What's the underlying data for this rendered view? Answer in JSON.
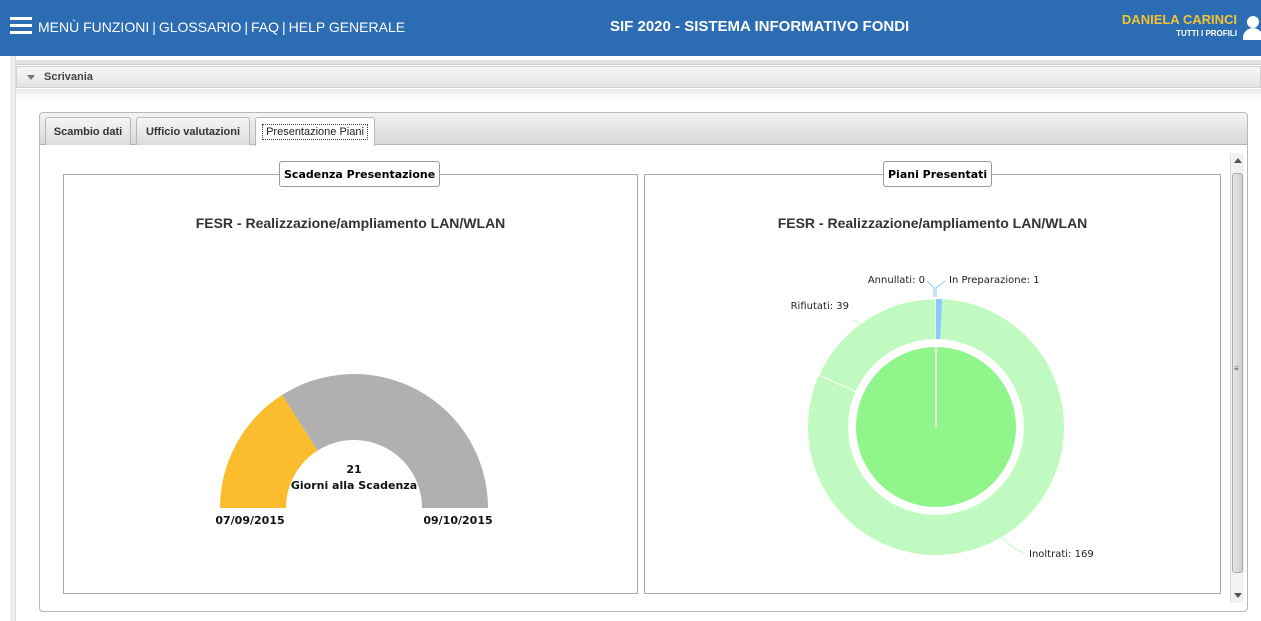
{
  "header": {
    "menu": [
      "MENÙ FUNZIONI",
      "GLOSSARIO",
      "FAQ",
      "HELP GENERALE"
    ],
    "app_title": "SIF 2020 - SISTEMA INFORMATIVO FONDI",
    "user_name": "DANIELA CARINCI",
    "profile": "TUTTI I PROFILI",
    "colors": {
      "bar": "#2b6cb3",
      "user_name": "#f4c430"
    }
  },
  "section": {
    "label": "Scrivania"
  },
  "tabs": [
    {
      "label": "Scambio dati",
      "active": false
    },
    {
      "label": "Ufficio valutazioni",
      "active": false
    },
    {
      "label": "Presentazione Piani",
      "active": true
    }
  ],
  "left_panel": {
    "legend": "Scadenza Presentazione",
    "title": "FESR - Realizzazione/ampliamento LAN/WLAN",
    "gauge_value": "21",
    "gauge_label": "Giorni alla Scadenza",
    "start_date": "07/09/2015",
    "end_date": "09/10/2015"
  },
  "right_panel": {
    "legend": "Piani Presentati",
    "title": "FESR - Realizzazione/ampliamento LAN/WLAN",
    "labels": {
      "annullati": "Annullati: 0",
      "in_preparazione": "In Preparazione: 1",
      "rifiutati": "Rifiutati: 39",
      "inoltrati": "Inoltrati: 169"
    }
  },
  "chart_data": [
    {
      "type": "gauge",
      "title": "FESR - Realizzazione/ampliamento LAN/WLAN",
      "min_label": "07/09/2015",
      "max_label": "09/10/2015",
      "value": 21,
      "value_label": "Giorni alla Scadenza",
      "filled_fraction": 0.32,
      "colors": {
        "filled": "#fbbd2d",
        "remaining": "#b0b0b0"
      }
    },
    {
      "type": "pie",
      "title": "FESR - Realizzazione/ampliamento LAN/WLAN",
      "categories": [
        "Inoltrati",
        "Rifiutati",
        "Annullati",
        "In Preparazione"
      ],
      "values": [
        169,
        39,
        0,
        1
      ],
      "colors": {
        "outer": "#c0fac0",
        "inner": "#90f58a",
        "accent": "#8ec8ff"
      }
    }
  ]
}
